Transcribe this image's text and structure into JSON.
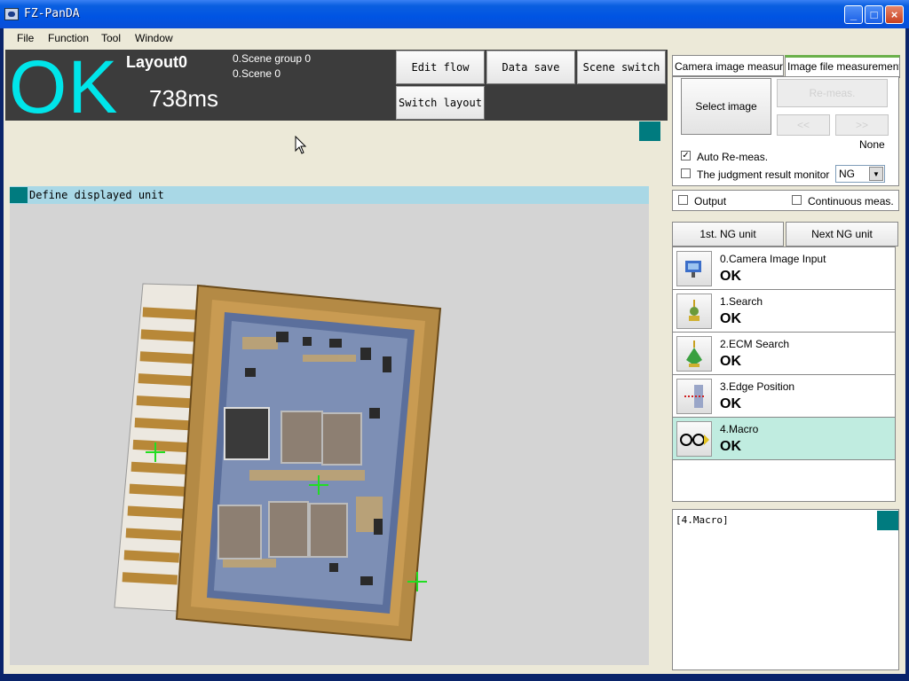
{
  "window": {
    "title": "FZ-PanDA"
  },
  "menu": [
    "File",
    "Function",
    "Tool",
    "Window"
  ],
  "status": {
    "judgement": "OK",
    "layout": "Layout0",
    "time": "738ms",
    "scene_group": "0.Scene group 0",
    "scene": "0.Scene 0"
  },
  "toolbar": {
    "edit_flow": "Edit flow",
    "data_save": "Data save",
    "scene_switch": "Scene switch",
    "switch_layout": "Switch layout"
  },
  "image_panel": {
    "header": "Define displayed unit"
  },
  "measure": {
    "tab_camera": "Camera image measurement",
    "tab_file": "Image file measurement",
    "select_image": "Select image",
    "remeas": "Re-meas.",
    "prev": "<<",
    "next": ">>",
    "file_name": "None",
    "auto_remeas": "Auto Re-meas.",
    "auto_remeas_checked": true,
    "judgment_monitor": "The judgment result monitor",
    "judgment_monitor_value": "NG",
    "output": "Output",
    "continuous": "Continuous meas."
  },
  "ng_nav": {
    "first": "1st. NG unit",
    "next": "Next NG unit"
  },
  "units": [
    {
      "name": "0.Camera Image Input",
      "result": "OK",
      "icon": "camera-input-icon"
    },
    {
      "name": "1.Search",
      "result": "OK",
      "icon": "search-unit-icon"
    },
    {
      "name": "2.ECM Search",
      "result": "OK",
      "icon": "ecm-search-icon"
    },
    {
      "name": "3.Edge Position",
      "result": "OK",
      "icon": "edge-position-icon"
    },
    {
      "name": "4.Macro",
      "result": "OK",
      "icon": "macro-icon",
      "selected": true
    }
  ],
  "detail": {
    "text": "[4.Macro]"
  },
  "colors": {
    "ok": "#00e5ea",
    "accent_teal": "#007b7f",
    "selected_row": "#c0ece0",
    "cross": "#22dd22"
  }
}
